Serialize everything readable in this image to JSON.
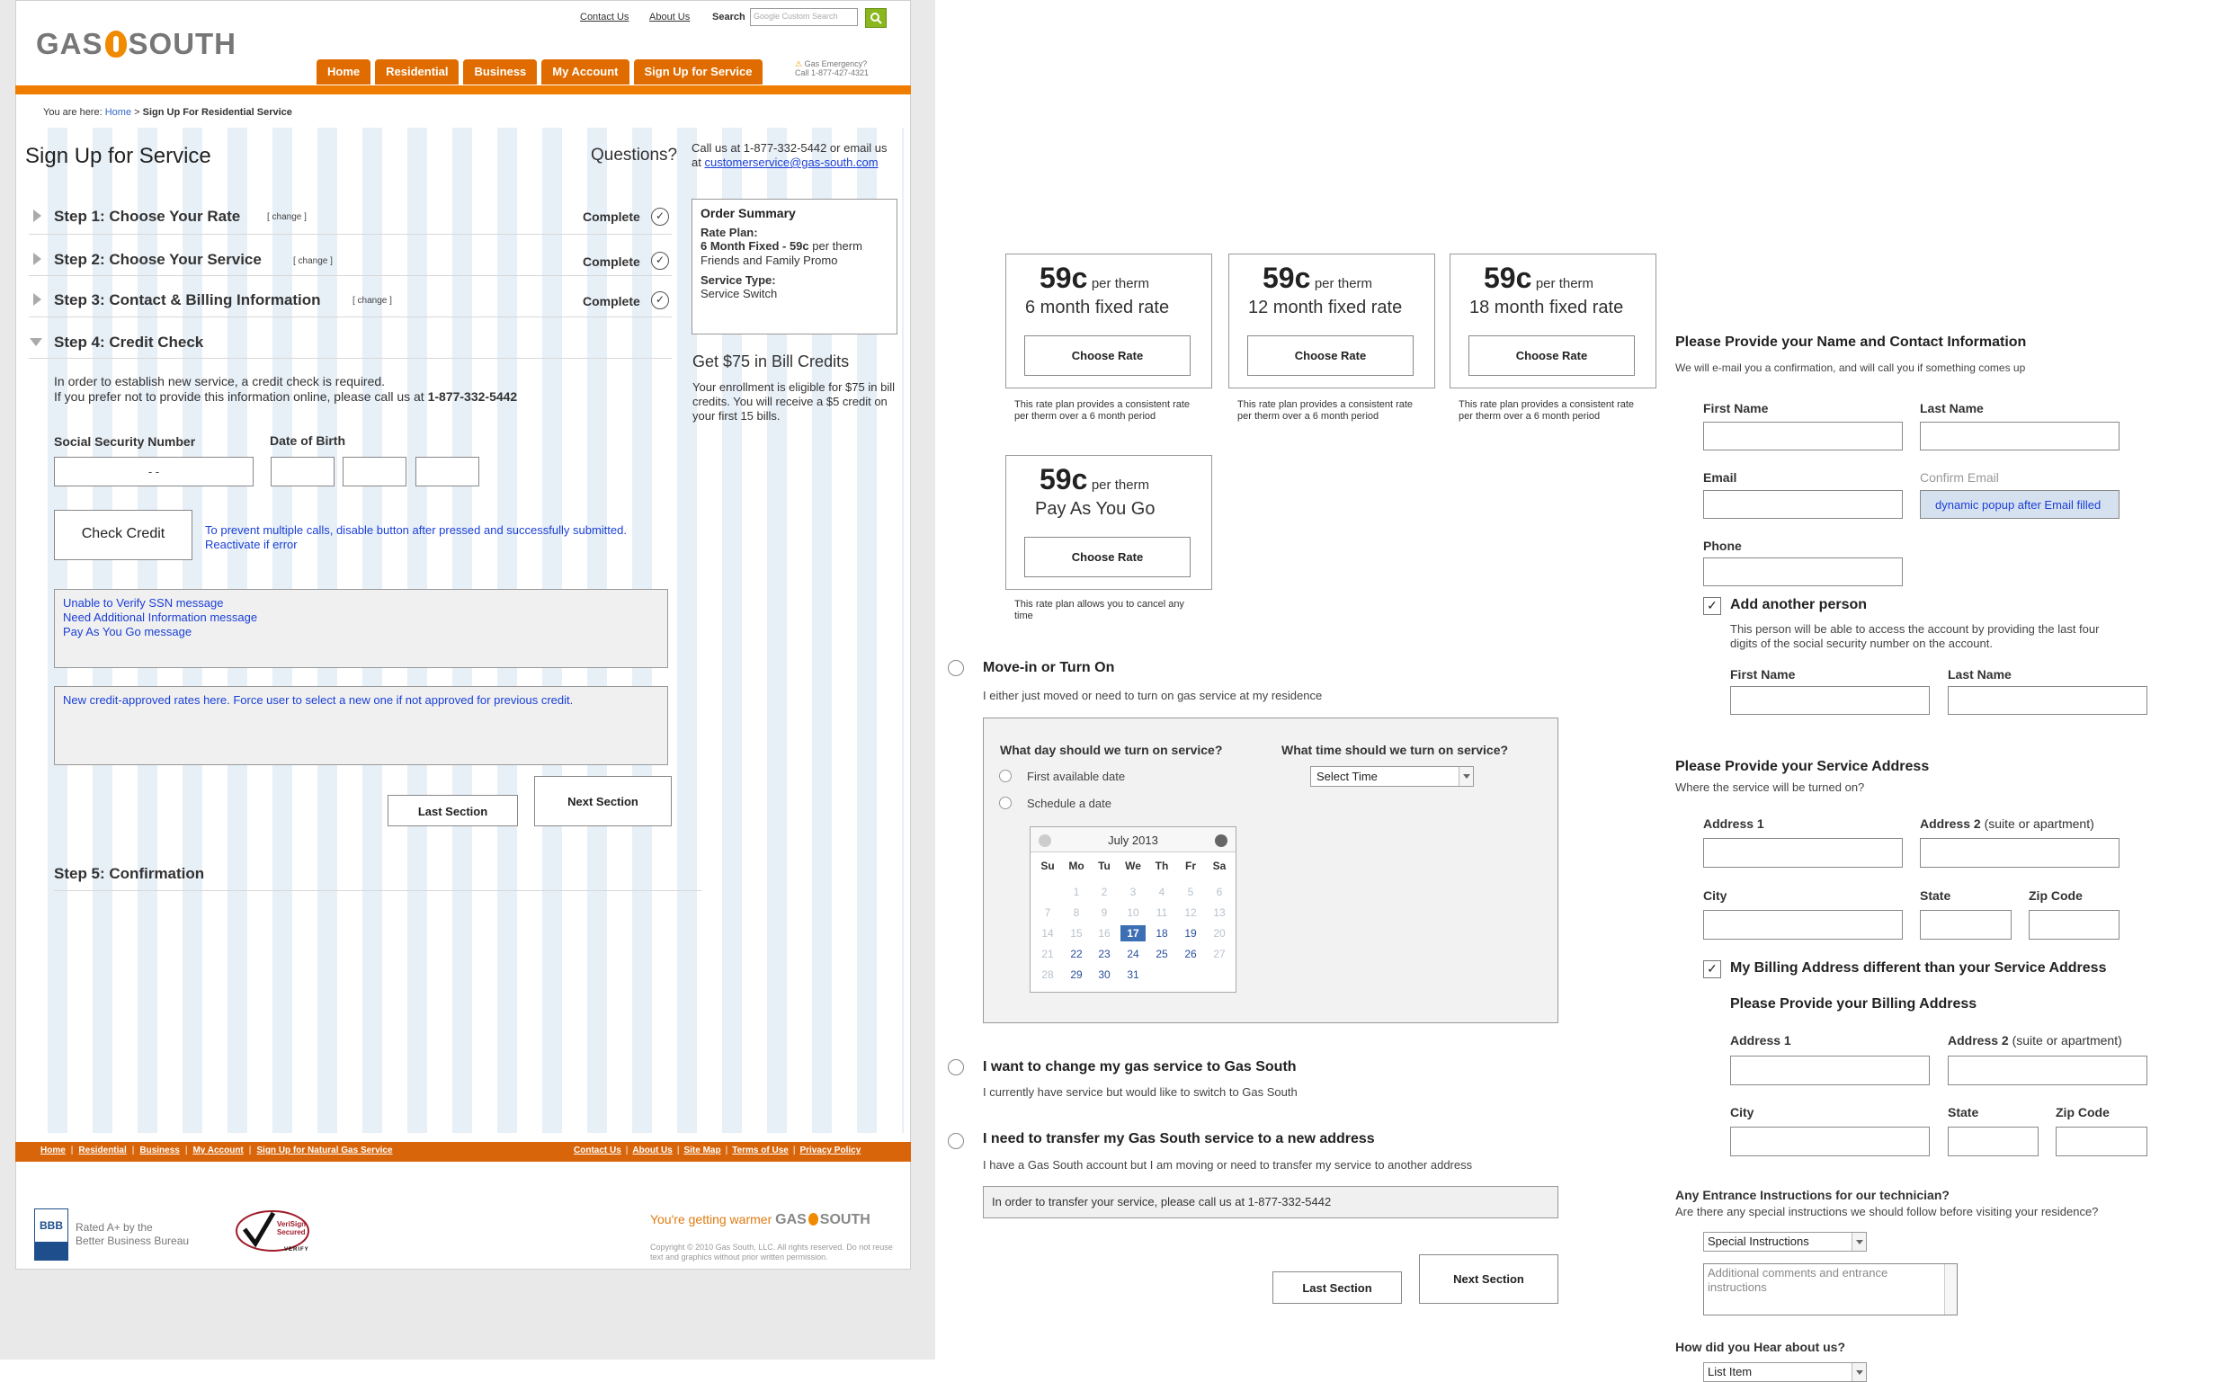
{
  "site": {
    "logo_left": "GAS",
    "logo_right": "SOUTH",
    "top_links": [
      "Contact Us",
      "About Us"
    ],
    "search_label": "Search",
    "search_placeholder": "Google Custom Search",
    "nav_tabs": [
      "Home",
      "Residential",
      "Business",
      "My Account",
      "Sign Up for Service"
    ],
    "emergency_line1": "Gas Emergency?",
    "emergency_line2": "Call 1-877-427-4321"
  },
  "breadcrumb": {
    "prefix": "You are here:",
    "home": "Home",
    "sep": ">",
    "current": "Sign Up For Residential Service"
  },
  "main": {
    "title": "Sign Up for Service",
    "questions": "Questions?",
    "steps": [
      {
        "label": "Step 1: Choose Your Rate",
        "change": "[ change ]",
        "status": "Complete"
      },
      {
        "label": "Step 2: Choose Your Service",
        "change": "[ change ]",
        "status": "Complete"
      },
      {
        "label": "Step 3: Contact & Billing Information",
        "change": "[ change ]",
        "status": "Complete"
      }
    ],
    "step4": {
      "label": "Step 4: Credit Check",
      "intro1": "In order to establish new service, a credit check is required.",
      "intro2": "If you prefer not to provide this information online, please call us at",
      "phone": "1-877-332-5442",
      "ssn_label": "Social Security Number",
      "ssn_value": "-     -",
      "dob_label": "Date of Birth",
      "check_button": "Check Credit",
      "check_note1": "To prevent multiple calls, disable button after pressed and successfully submitted.",
      "check_note2": "Reactivate if error",
      "messages": [
        "Unable to Verify SSN message",
        "Need Additional Information message",
        "Pay As You Go message"
      ],
      "rates_note": "New credit-approved rates here. Force user to select a new one if not approved for previous credit.",
      "last_button": "Last Section",
      "next_button": "Next Section"
    },
    "step5": "Step 5: Confirmation"
  },
  "sidebar": {
    "call_text": "Call us at 1-877-332-5442 or email us at",
    "email": "customerservice@gas-south.com",
    "order_title": "Order Summary",
    "rate_plan_label": "Rate Plan:",
    "rate_plan_bold": "6 Month Fixed - 59c",
    "rate_plan_rest": "per therm",
    "rate_plan_promo": "Friends and Family Promo",
    "service_type_label": "Service Type:",
    "service_type_value": "Service Switch",
    "credits_title": "Get $75 in Bill Credits",
    "credits_text": "Your enrollment is eligible for $75 in bill credits. You will receive a $5 credit on your first 15 bills."
  },
  "footer": {
    "left_links": [
      "Home",
      "Residential",
      "Business",
      "My Account",
      "Sign Up for Natural Gas Service"
    ],
    "right_links": [
      "Contact Us",
      "About Us",
      "Site Map",
      "Terms of Use",
      "Privacy Policy"
    ],
    "bbb_line1": "Rated A+ by the",
    "bbb_line2": "Better Business Bureau",
    "bbb_badge": "BBB",
    "verisign_line1": "VeriSign",
    "verisign_line2": "Secured",
    "verisign_line3": "VERIFY",
    "tagline": "You're getting warmer",
    "copyright": "Copyright © 2010 Gas South, LLC. All rights reserved. Do not reuse text and graphics without prior written permission."
  },
  "rates": [
    {
      "price": "59c",
      "per": "per therm",
      "name": "6 month fixed rate",
      "button": "Choose Rate",
      "desc": "This rate plan provides a consistent rate per therm over a 6 month period"
    },
    {
      "price": "59c",
      "per": "per therm",
      "name": "12 month fixed rate",
      "button": "Choose Rate",
      "desc": "This rate plan provides a consistent rate per therm over a 6 month period"
    },
    {
      "price": "59c",
      "per": "per therm",
      "name": "18 month fixed rate",
      "button": "Choose Rate",
      "desc": "This rate plan provides a consistent rate per therm over a 6 month period"
    },
    {
      "price": "59c",
      "per": "per therm",
      "name": "Pay As You Go",
      "button": "Choose Rate",
      "desc": "This rate plan allows you to cancel any time"
    }
  ],
  "service_options": {
    "movein_title": "Move-in or Turn On",
    "movein_desc": "I either just moved or need to turn on gas service at my residence",
    "day_q": "What day should we turn on service?",
    "time_q": "What time should we turn on service?",
    "first_avail": "First available date",
    "schedule": "Schedule a date",
    "time_select": "Select Time",
    "change_title": "I want to change my gas service to Gas South",
    "change_desc": "I currently have service but would like to switch to Gas South",
    "transfer_title": "I need to transfer my Gas South service to a new address",
    "transfer_desc": "I have a Gas South account but I am moving or need to transfer my service to another address",
    "transfer_note": "In order to transfer your service, please call us at 1-877-332-5442",
    "last_button": "Last Section",
    "next_button": "Next Section"
  },
  "calendar": {
    "month": "July 2013",
    "days": [
      "Su",
      "Mo",
      "Tu",
      "We",
      "Th",
      "Fr",
      "Sa"
    ],
    "weeks": [
      [
        "",
        "1",
        "2",
        "3",
        "4",
        "5",
        "6"
      ],
      [
        "7",
        "8",
        "9",
        "10",
        "11",
        "12",
        "13"
      ],
      [
        "14",
        "15",
        "16",
        "17",
        "18",
        "19",
        "20"
      ],
      [
        "21",
        "22",
        "23",
        "24",
        "25",
        "26",
        "27"
      ],
      [
        "28",
        "29",
        "30",
        "31",
        "",
        "",
        ""
      ]
    ],
    "selected": "17"
  },
  "contact": {
    "heading": "Please Provide your Name and Contact Information",
    "subtext": "We will e-mail you a confirmation, and will call you if something comes up",
    "first_name": "First Name",
    "last_name": "Last Name",
    "email": "Email",
    "confirm_email": "Confirm Email",
    "confirm_note": "dynamic popup after Email filled",
    "phone": "Phone",
    "add_person": "Add another person",
    "add_person_desc": "This person will be able to access the account by providing the last four digits of the social security number on the account.",
    "first_name2": "First Name",
    "last_name2": "Last Name"
  },
  "address": {
    "heading": "Please Provide your Service Address",
    "subtext": "Where the service will be turned on?",
    "address1": "Address 1",
    "address2": "Address 2",
    "address2_hint": "(suite or apartment)",
    "city": "City",
    "state": "State",
    "zip": "Zip Code",
    "billing_diff": "My Billing Address different than your Service Address",
    "billing_heading": "Please Provide your Billing Address",
    "b_address1": "Address 1",
    "b_address2": "Address 2",
    "b_address2_hint": "(suite or apartment)",
    "b_city": "City",
    "b_state": "State",
    "b_zip": "Zip Code",
    "entrance_heading": "Any Entrance Instructions for our technician?",
    "entrance_sub": "Are there any special instructions we should follow before visiting your residence?",
    "special_select": "Special Instructions",
    "comments_placeholder": "Additional comments and entrance instructions",
    "hear_heading": "How did you Hear about us?",
    "hear_select": "List Item"
  },
  "colors": {
    "brand_orange": "#f07d00",
    "tab_orange": "#e06c00",
    "footer_orange": "#d9650a",
    "note_blue": "#1a3fd6",
    "calendar_selected": "#3d6fb5"
  }
}
